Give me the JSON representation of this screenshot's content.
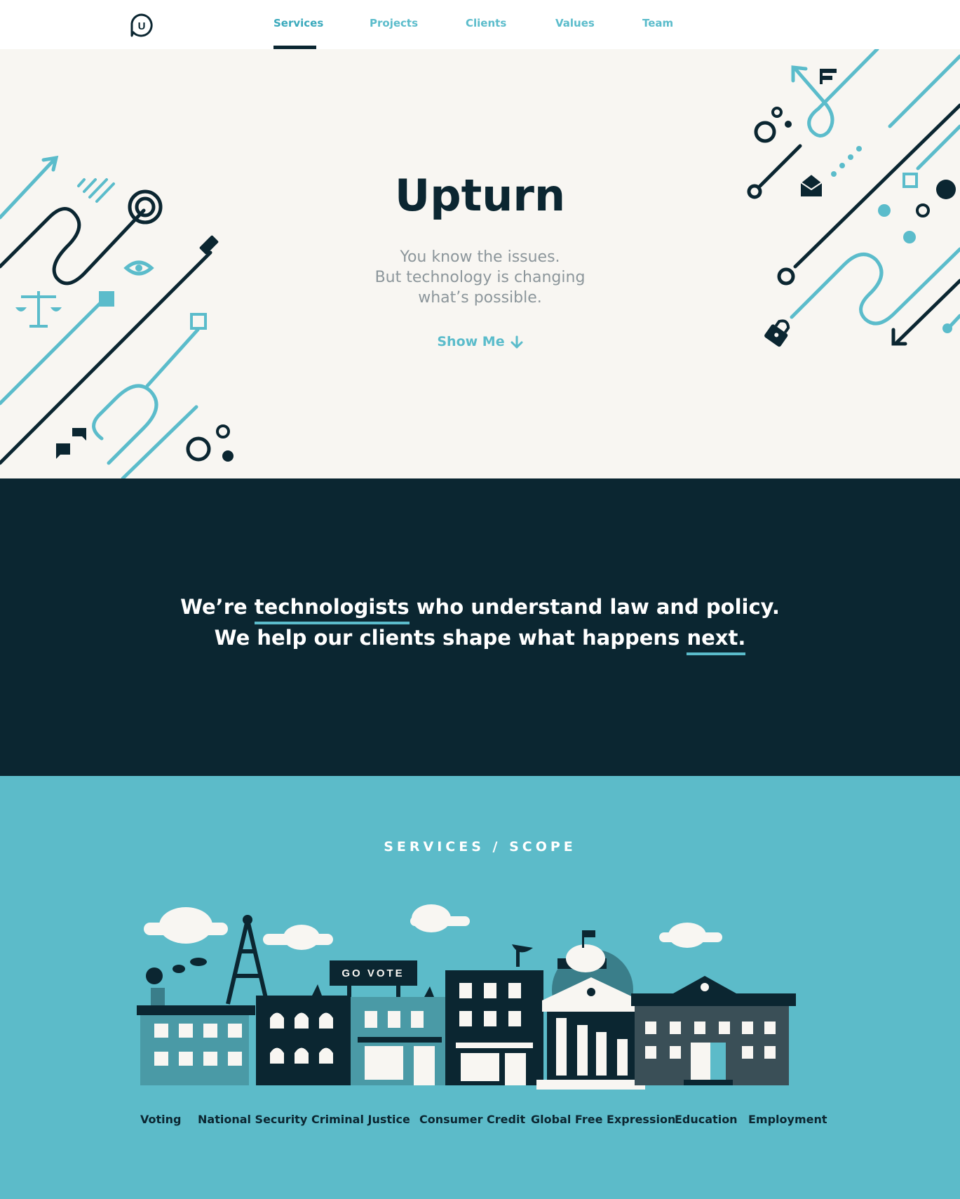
{
  "nav": {
    "logo_letter": "U",
    "links": [
      {
        "label": "Services",
        "active": true
      },
      {
        "label": "Projects",
        "active": false
      },
      {
        "label": "Clients",
        "active": false
      },
      {
        "label": "Values",
        "active": false
      },
      {
        "label": "Team",
        "active": false
      }
    ]
  },
  "hero": {
    "title": "Upturn",
    "subtitle_lines": [
      "You know the issues.",
      "But technology is changing",
      "what’s possible."
    ],
    "cta_label": "Show Me",
    "cta_icon": "arrow-down-icon"
  },
  "mission": {
    "line1_before": "We’re ",
    "line1_highlight": "technologists",
    "line1_after": " who understand law and policy.",
    "line2_before": "We help our clients shape what happens ",
    "line2_highlight": "next.",
    "line2_after": ""
  },
  "services": {
    "heading": "SERVICES / SCOPE",
    "billboard_text": "GO VOTE",
    "scopes": [
      "Voting",
      "National Security",
      "Criminal Justice",
      "Consumer Credit",
      "Global Free Expression",
      "Education",
      "Employment"
    ]
  },
  "colors": {
    "navy": "#0b2631",
    "teal": "#5bbccb",
    "cream": "#f8f6f2",
    "grey_text": "#8c969b",
    "slate": "#3a4f57",
    "mid_teal": "#4a9aa6"
  }
}
